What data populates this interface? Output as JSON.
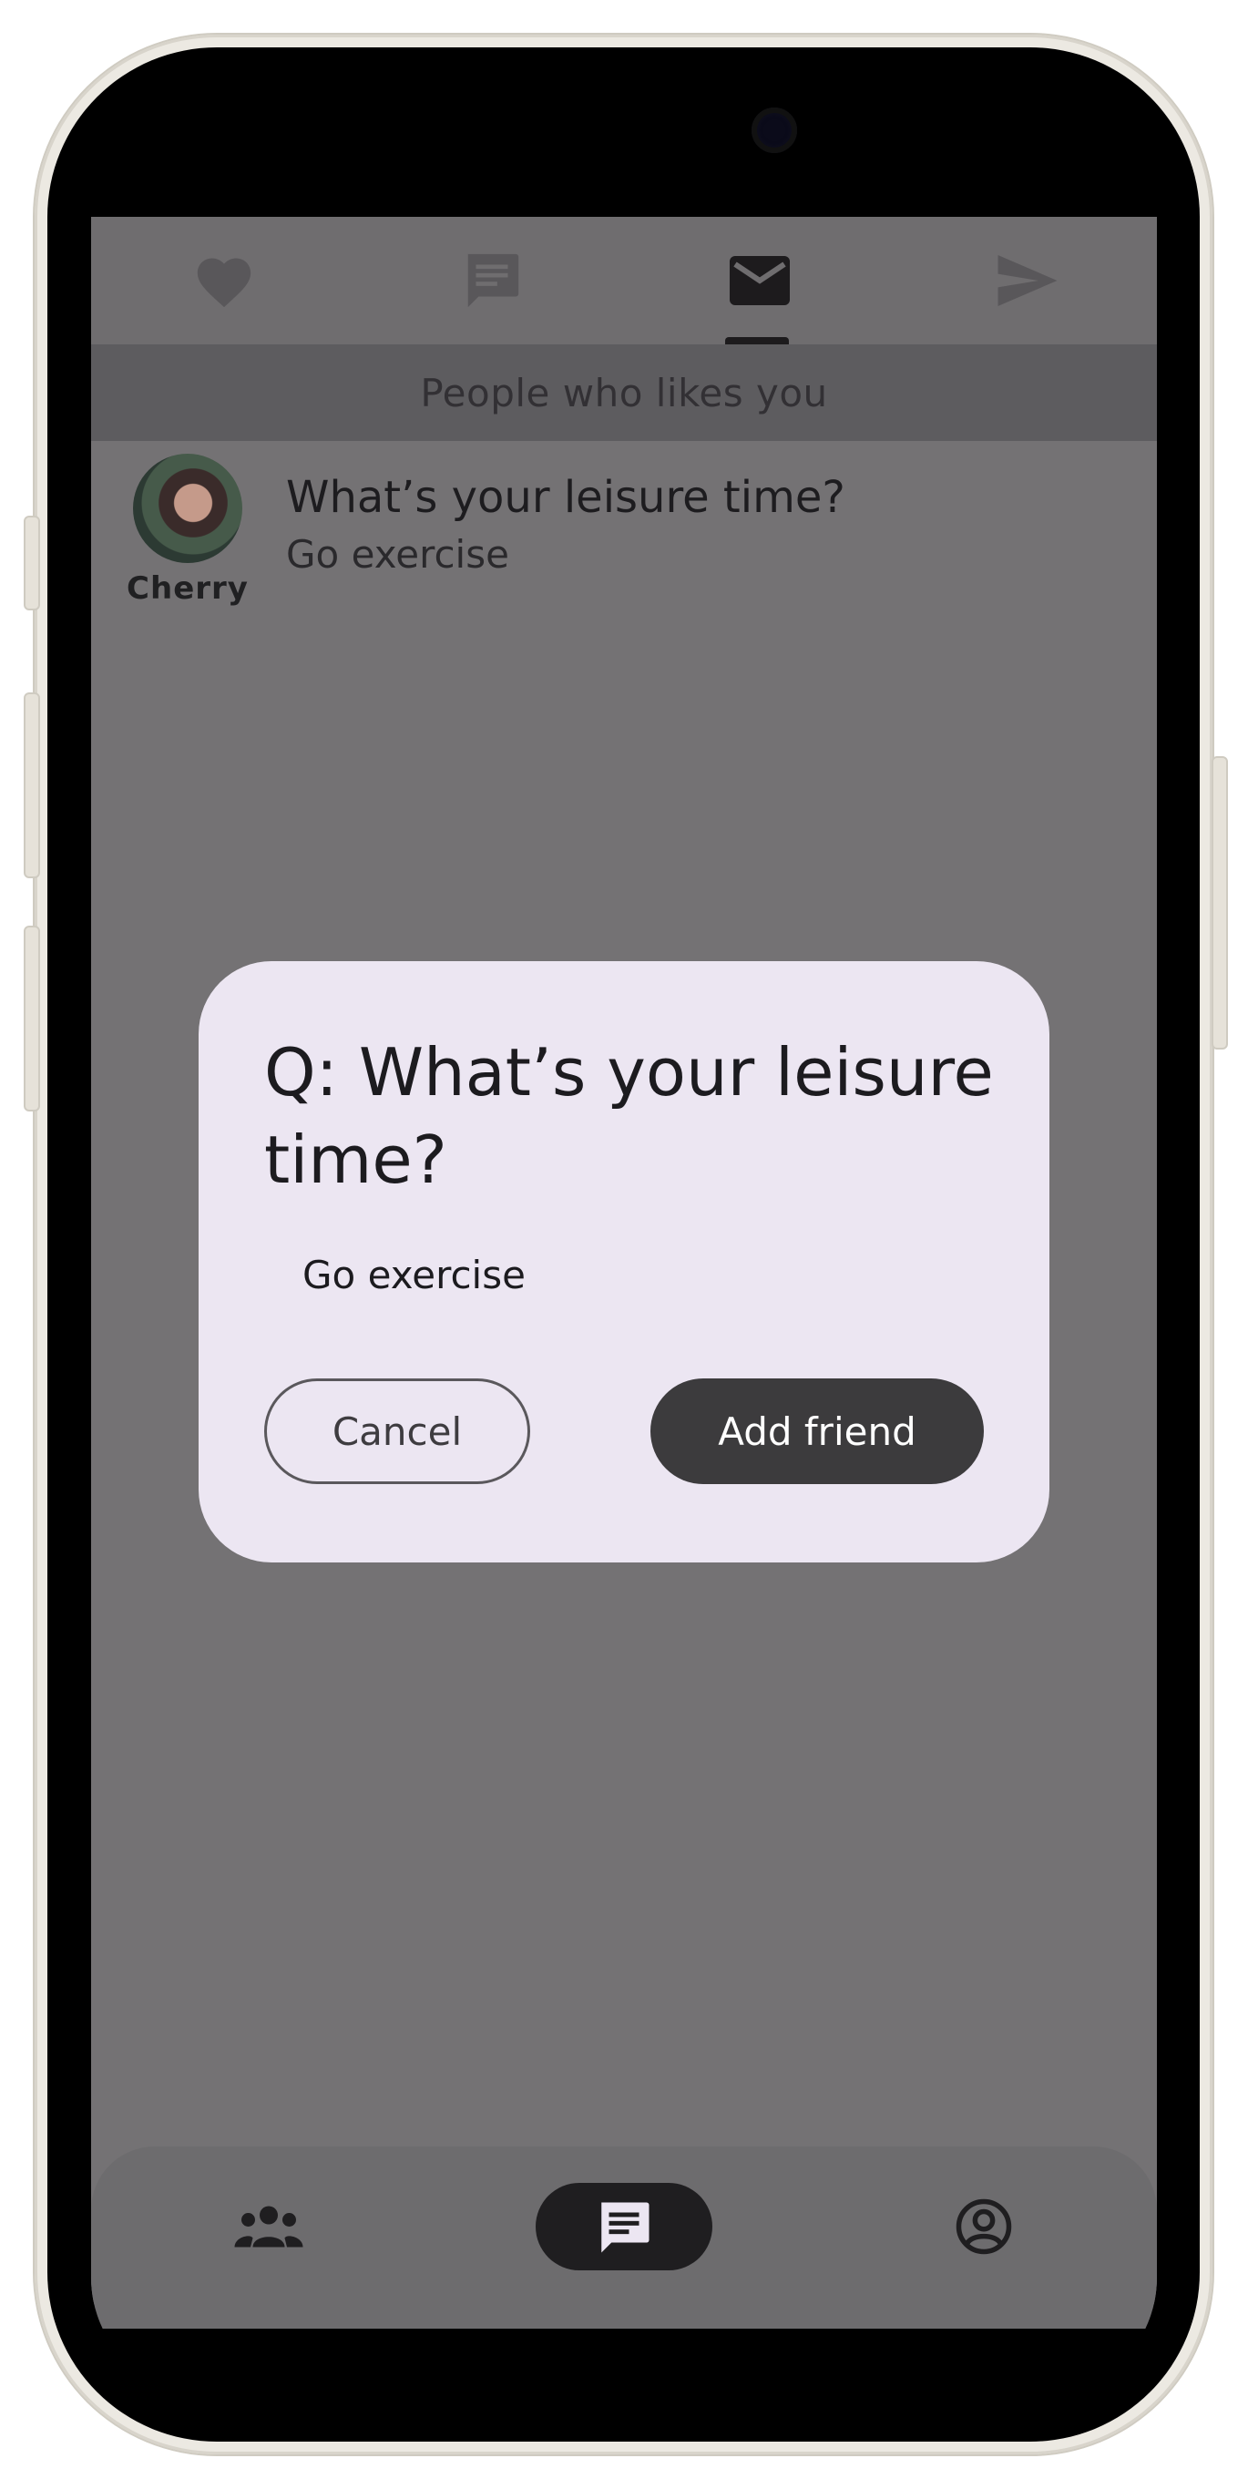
{
  "top_tabs": [
    {
      "icon": "heart-icon"
    },
    {
      "icon": "chat-bubble-icon"
    },
    {
      "icon": "mail-icon",
      "selected": true
    },
    {
      "icon": "send-icon"
    }
  ],
  "subheader": {
    "title": "People who likes you"
  },
  "list": [
    {
      "name": "Cherry",
      "question": "What’s your leisure time?",
      "answer": "Go exercise"
    }
  ],
  "dialog": {
    "title": "Q: What’s your leisure time?",
    "answer": "Go exercise",
    "cancel_label": "Cancel",
    "add_label": "Add friend"
  },
  "bottom_nav": [
    {
      "icon": "groups-icon"
    },
    {
      "icon": "chat-icon",
      "selected": true
    },
    {
      "icon": "account-circle-icon"
    }
  ],
  "colors": {
    "scrim": "#747274",
    "dialog_bg": "#ece6f2",
    "primary_button": "#3c3b3d",
    "selected_pill": "#1f1e20"
  }
}
